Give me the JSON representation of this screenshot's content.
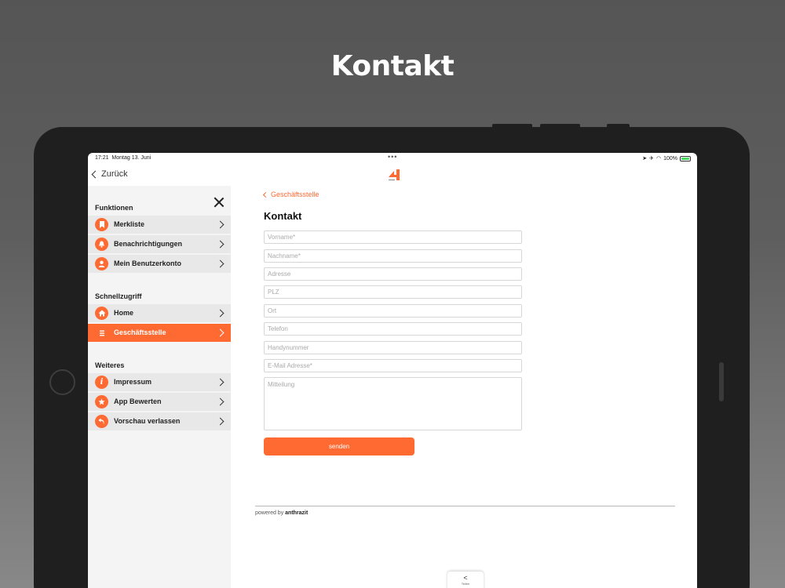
{
  "hero": {
    "title": "Kontakt"
  },
  "status_bar": {
    "time": "17:21",
    "date": "Montag 13. Juni",
    "battery": "100%"
  },
  "nav": {
    "back_label": "Zurück"
  },
  "sidebar": {
    "sections": [
      {
        "title": "Funktionen"
      },
      {
        "title": "Schnellzugriff"
      },
      {
        "title": "Weiteres"
      }
    ],
    "items": [
      {
        "label": "Merkliste",
        "icon": "bookmark-icon"
      },
      {
        "label": "Benachrichtigungen",
        "icon": "bell-icon"
      },
      {
        "label": "Mein Benutzerkonto",
        "icon": "user-icon"
      },
      {
        "label": "Home",
        "icon": "home-icon"
      },
      {
        "label": "Geschäftsstelle",
        "icon": "list-icon",
        "active": true
      },
      {
        "label": "Impressum",
        "icon": "info-icon"
      },
      {
        "label": "App Bewerten",
        "icon": "star-icon"
      },
      {
        "label": "Vorschau verlassen",
        "icon": "undo-icon"
      }
    ]
  },
  "content": {
    "breadcrumb": "Geschäftsstelle",
    "title": "Kontakt",
    "form": {
      "first_name_placeholder": "Vorname*",
      "last_name_placeholder": "Nachname*",
      "address_placeholder": "Adresse",
      "zip_placeholder": "PLZ",
      "city_placeholder": "Ort",
      "phone_placeholder": "Telefon",
      "mobile_placeholder": "Handynummer",
      "email_placeholder": "E-Mail Adresse*",
      "message_placeholder": "Mitteilung",
      "submit_label": "senden"
    },
    "footer_prefix": "powered by",
    "footer_brand": "anthrazit"
  },
  "share": {
    "label": "Teilen"
  },
  "colors": {
    "accent": "#ff6a33",
    "sidebar_bg": "#f4f4f4",
    "item_bg": "#e8e8e8"
  }
}
